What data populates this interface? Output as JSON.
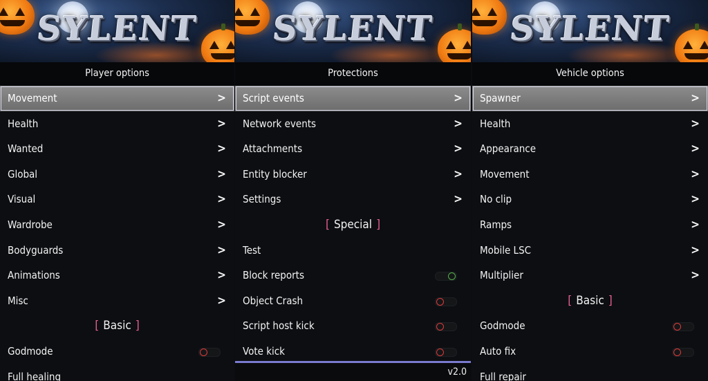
{
  "brand": {
    "logo_text": "SYLENT"
  },
  "panels": [
    {
      "title": "Player options",
      "items": [
        {
          "label": "Movement",
          "kind": "submenu",
          "selected": true
        },
        {
          "label": "Health",
          "kind": "submenu"
        },
        {
          "label": "Wanted",
          "kind": "submenu"
        },
        {
          "label": "Global",
          "kind": "submenu"
        },
        {
          "label": "Visual",
          "kind": "submenu"
        },
        {
          "label": "Wardrobe",
          "kind": "submenu"
        },
        {
          "label": "Bodyguards",
          "kind": "submenu"
        },
        {
          "label": "Animations",
          "kind": "submenu"
        },
        {
          "label": "Misc",
          "kind": "submenu"
        },
        {
          "label": "Basic",
          "kind": "section"
        },
        {
          "label": "Godmode",
          "kind": "toggle",
          "on": false
        },
        {
          "label": "Full healing",
          "kind": "action"
        }
      ]
    },
    {
      "title": "Protections",
      "items": [
        {
          "label": "Script events",
          "kind": "submenu",
          "selected": true
        },
        {
          "label": "Network events",
          "kind": "submenu"
        },
        {
          "label": "Attachments",
          "kind": "submenu"
        },
        {
          "label": "Entity blocker",
          "kind": "submenu"
        },
        {
          "label": "Settings",
          "kind": "submenu"
        },
        {
          "label": "Special",
          "kind": "section"
        },
        {
          "label": "Test",
          "kind": "action"
        },
        {
          "label": "Block reports",
          "kind": "toggle",
          "on": true
        },
        {
          "label": "Object Crash",
          "kind": "toggle",
          "on": false
        },
        {
          "label": "Script host kick",
          "kind": "toggle",
          "on": false
        },
        {
          "label": "Vote kick",
          "kind": "toggle",
          "on": false
        }
      ],
      "version": "v2.0"
    },
    {
      "title": "Vehicle options",
      "items": [
        {
          "label": "Spawner",
          "kind": "submenu",
          "selected": true
        },
        {
          "label": "Health",
          "kind": "submenu"
        },
        {
          "label": "Appearance",
          "kind": "submenu"
        },
        {
          "label": "Movement",
          "kind": "submenu"
        },
        {
          "label": "No clip",
          "kind": "submenu"
        },
        {
          "label": "Ramps",
          "kind": "submenu"
        },
        {
          "label": "Mobile LSC",
          "kind": "submenu"
        },
        {
          "label": "Multiplier",
          "kind": "submenu"
        },
        {
          "label": "Basic",
          "kind": "section"
        },
        {
          "label": "Godmode",
          "kind": "toggle",
          "on": false
        },
        {
          "label": "Auto fix",
          "kind": "toggle",
          "on": false
        },
        {
          "label": "Full repair",
          "kind": "action"
        }
      ]
    }
  ],
  "glyphs": {
    "chevron": ">",
    "bracket_open": "[",
    "bracket_close": "]"
  },
  "colors": {
    "selected_bg": "#7a7a7a",
    "section_bracket": "#e8608f",
    "toggle_off": "#e03a3a",
    "toggle_on": "#55b04a",
    "footer_line": "#7a7ad0"
  }
}
